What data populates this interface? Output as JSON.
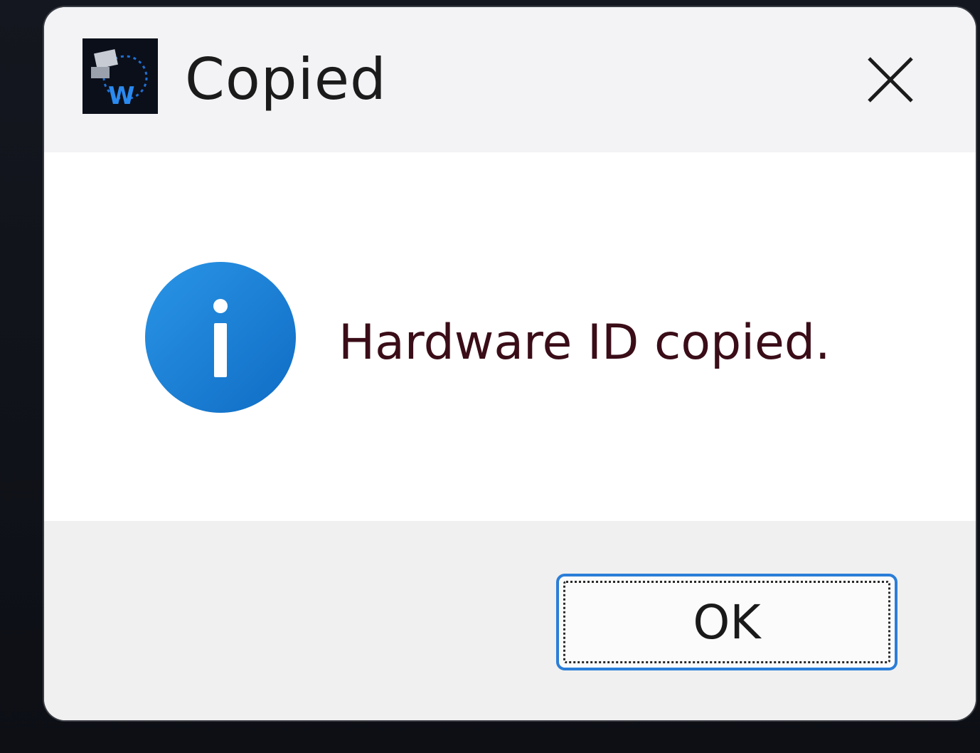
{
  "dialog": {
    "title": "Copied",
    "app_icon": "app-logo-icon",
    "close_icon": "close-icon",
    "message_icon": "info-icon",
    "message": "Hardware ID copied.",
    "ok_label": "OK"
  },
  "colors": {
    "titlebar_bg": "#f3f3f6",
    "content_bg": "#ffffff",
    "footer_bg": "#f0f0f0",
    "info_blue": "#1a7fd4",
    "button_focus_border": "#2b7ed8",
    "message_text": "#3a0d18"
  }
}
